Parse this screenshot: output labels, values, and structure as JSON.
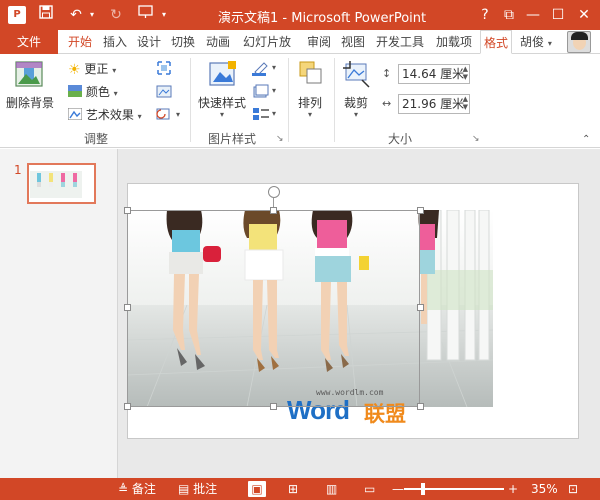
{
  "app": {
    "logo_letter": "P",
    "title": "演示文稿1 - Microsoft PowerPoint"
  },
  "window_controls": {
    "help": "?",
    "restore": "⧉",
    "minimize": "—",
    "maximize": "☐",
    "close": "✕"
  },
  "tabs": {
    "file": "文件",
    "items": [
      "开始",
      "插入",
      "设计",
      "切换",
      "动画",
      "幻灯片放",
      "审阅",
      "视图",
      "开发工具",
      "加载项",
      "格式"
    ],
    "active": "格式",
    "user_name": "胡俊"
  },
  "ribbon": {
    "adjust": {
      "remove_bg": "删除背景",
      "corrections": "更正",
      "color": "颜色",
      "artistic": "艺术效果",
      "group_label": "调整"
    },
    "picture_styles": {
      "quick_styles": "快速样式",
      "group_label": "图片样式"
    },
    "arrange": {
      "label": "排列"
    },
    "size": {
      "crop": "裁剪",
      "height": "14.64 厘米",
      "width": "21.96 厘米",
      "group_label": "大小"
    }
  },
  "slides": {
    "current_number": "1"
  },
  "watermark": {
    "url": "www.wordlm.com",
    "brand_word": "Word",
    "brand_cn": "联盟"
  },
  "status": {
    "notes": "备注",
    "comments": "批注",
    "zoom": "35%"
  },
  "colors": {
    "accent": "#d24726",
    "brand_blue": "#1e6fc5",
    "brand_orange": "#f08a1c"
  }
}
